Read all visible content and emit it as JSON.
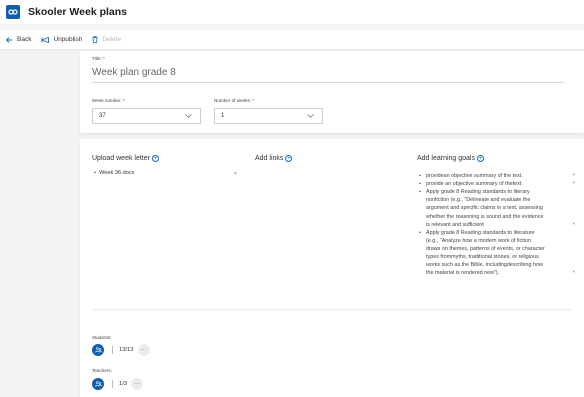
{
  "app": {
    "title": "Skooler Week plans",
    "brand_color": "#0f5ea8"
  },
  "toolbar": {
    "back_label": "Back",
    "unpublish_label": "Unpublish",
    "delete_label": "Delete"
  },
  "form": {
    "title_label": "Title: *",
    "title_value": "Week plan grade 8",
    "week_number_label": "Week number: *",
    "week_number_value": "37",
    "number_of_weeks_label": "Number of weeks: *",
    "number_of_weeks_value": "1"
  },
  "sections": {
    "upload_label": "Upload week letter",
    "links_label": "Add links",
    "goals_label": "Add learning goals"
  },
  "files": [
    {
      "name": "Week 36.docx"
    }
  ],
  "goals": [
    {
      "lines": [
        "providean objective summary of the text."
      ]
    },
    {
      "lines": [
        "provide an objective summary of thetext."
      ]
    },
    {
      "lines": [
        "Apply grade 8 Reading standards to literary",
        "nonfiction (e.g., \"Delineate and evaluate the",
        "argument and specific claims in a text, assessing",
        "whether the reasoning is sound and the evidence",
        "is relevant and sufficient"
      ]
    },
    {
      "lines": [
        "Apply grade 8 Reading standards to literature",
        "(e.g., \"Analyze how a modern work of fiction",
        "draws on themes, patterns of events, or character",
        "types frommyths, traditional stories, or religious",
        "works such as the Bible, includingdescribing how",
        "the material is rendered new\")."
      ]
    }
  ],
  "students": {
    "label": "Students:",
    "count": "13/13"
  },
  "teachers": {
    "label": "Teachers:",
    "count": "1/3"
  }
}
